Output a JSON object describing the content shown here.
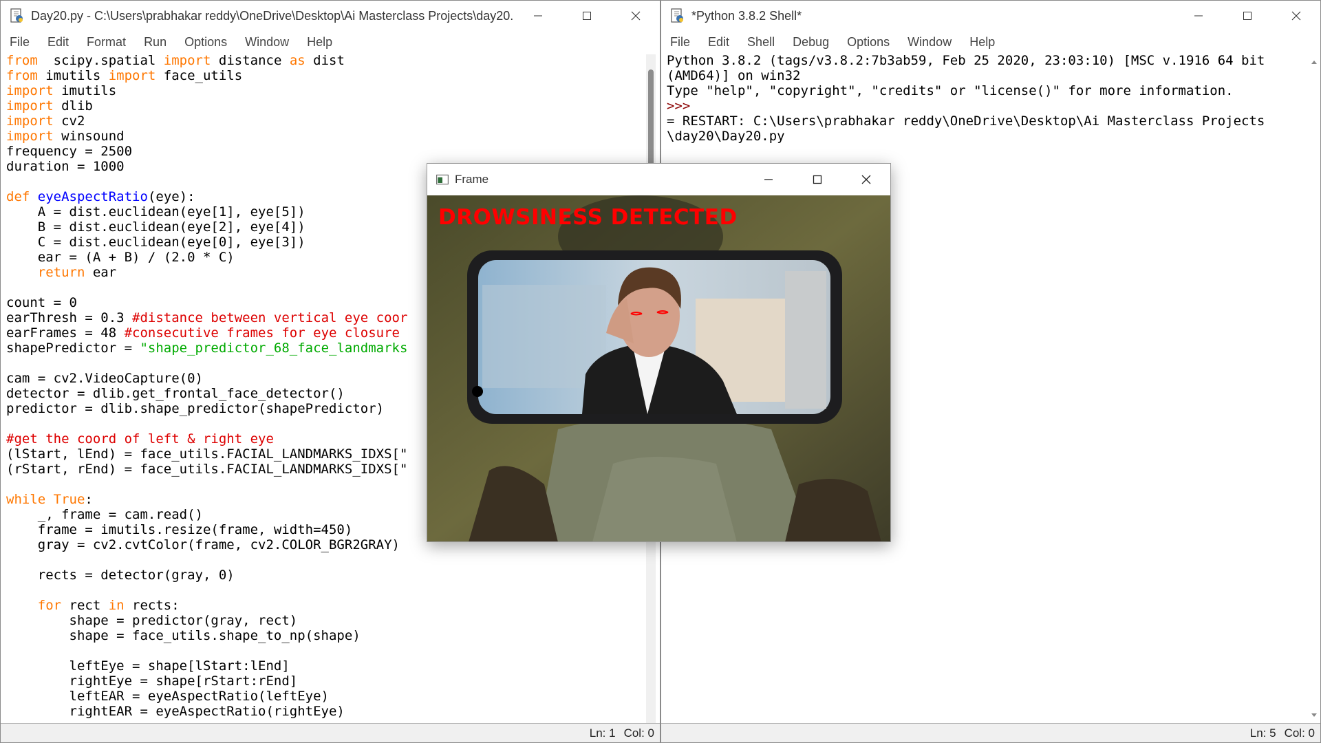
{
  "editor": {
    "title": "Day20.py - C:\\Users\\prabhakar reddy\\OneDrive\\Desktop\\Ai Masterclass Projects\\day20...",
    "menu": [
      "File",
      "Edit",
      "Format",
      "Run",
      "Options",
      "Window",
      "Help"
    ],
    "status": {
      "line": "Ln: 1",
      "col": "Col: 0"
    },
    "code_lines": [
      [
        [
          "kw",
          "from"
        ],
        [
          "",
          "  scipy.spatial "
        ],
        [
          "kw",
          "import"
        ],
        [
          "",
          " distance "
        ],
        [
          "kw",
          "as"
        ],
        [
          "",
          " dist"
        ]
      ],
      [
        [
          "kw",
          "from"
        ],
        [
          "",
          " imutils "
        ],
        [
          "kw",
          "import"
        ],
        [
          "",
          " face_utils"
        ]
      ],
      [
        [
          "kw",
          "import"
        ],
        [
          "",
          " imutils"
        ]
      ],
      [
        [
          "kw",
          "import"
        ],
        [
          "",
          " dlib"
        ]
      ],
      [
        [
          "kw",
          "import"
        ],
        [
          "",
          " cv2"
        ]
      ],
      [
        [
          "kw",
          "import"
        ],
        [
          "",
          " winsound"
        ]
      ],
      [
        [
          "",
          "frequency = 2500"
        ]
      ],
      [
        [
          "",
          "duration = 1000"
        ]
      ],
      [
        [
          "",
          ""
        ]
      ],
      [
        [
          "kw",
          "def"
        ],
        [
          "",
          " "
        ],
        [
          "fn",
          "eyeAspectRatio"
        ],
        [
          "",
          "(eye):"
        ]
      ],
      [
        [
          "",
          "    A = dist.euclidean(eye[1], eye[5])"
        ]
      ],
      [
        [
          "",
          "    B = dist.euclidean(eye[2], eye[4])"
        ]
      ],
      [
        [
          "",
          "    C = dist.euclidean(eye[0], eye[3])"
        ]
      ],
      [
        [
          "",
          "    ear = (A + B) / (2.0 * C)"
        ]
      ],
      [
        [
          "kw",
          "    return"
        ],
        [
          "",
          " ear"
        ]
      ],
      [
        [
          "",
          ""
        ]
      ],
      [
        [
          "",
          "count = 0"
        ]
      ],
      [
        [
          "",
          "earThresh = 0.3 "
        ],
        [
          "cm",
          "#distance between vertical eye coor"
        ]
      ],
      [
        [
          "",
          "earFrames = 48 "
        ],
        [
          "cm",
          "#consecutive frames for eye closure"
        ]
      ],
      [
        [
          "",
          "shapePredictor = "
        ],
        [
          "st",
          "\"shape_predictor_68_face_landmarks"
        ]
      ],
      [
        [
          "",
          ""
        ]
      ],
      [
        [
          "",
          "cam = cv2.VideoCapture(0)"
        ]
      ],
      [
        [
          "",
          "detector = dlib.get_frontal_face_detector()"
        ]
      ],
      [
        [
          "",
          "predictor = dlib.shape_predictor(shapePredictor)"
        ]
      ],
      [
        [
          "",
          ""
        ]
      ],
      [
        [
          "cm",
          "#get the coord of left & right eye"
        ]
      ],
      [
        [
          "",
          "(lStart, lEnd) = face_utils.FACIAL_LANDMARKS_IDXS[\""
        ]
      ],
      [
        [
          "",
          "(rStart, rEnd) = face_utils.FACIAL_LANDMARKS_IDXS[\""
        ]
      ],
      [
        [
          "",
          ""
        ]
      ],
      [
        [
          "kw",
          "while"
        ],
        [
          "",
          " "
        ],
        [
          "kw",
          "True"
        ],
        [
          "",
          ":"
        ]
      ],
      [
        [
          "",
          "    _, frame = cam.read()"
        ]
      ],
      [
        [
          "",
          "    frame = imutils.resize(frame, width=450)"
        ]
      ],
      [
        [
          "",
          "    gray = cv2.cvtColor(frame, cv2.COLOR_BGR2GRAY)"
        ]
      ],
      [
        [
          "",
          ""
        ]
      ],
      [
        [
          "",
          "    rects = detector(gray, 0)"
        ]
      ],
      [
        [
          "",
          ""
        ]
      ],
      [
        [
          "kw",
          "    for"
        ],
        [
          "",
          " rect "
        ],
        [
          "kw",
          "in"
        ],
        [
          "",
          " rects:"
        ]
      ],
      [
        [
          "",
          "        shape = predictor(gray, rect)"
        ]
      ],
      [
        [
          "",
          "        shape = face_utils.shape_to_np(shape)"
        ]
      ],
      [
        [
          "",
          ""
        ]
      ],
      [
        [
          "",
          "        leftEye = shape[lStart:lEnd]"
        ]
      ],
      [
        [
          "",
          "        rightEye = shape[rStart:rEnd]"
        ]
      ],
      [
        [
          "",
          "        leftEAR = eyeAspectRatio(leftEye)"
        ]
      ],
      [
        [
          "",
          "        rightEAR = eyeAspectRatio(rightEye)"
        ]
      ]
    ]
  },
  "shell": {
    "title": "*Python 3.8.2 Shell*",
    "menu": [
      "File",
      "Edit",
      "Shell",
      "Debug",
      "Options",
      "Window",
      "Help"
    ],
    "status": {
      "line": "Ln: 5",
      "col": "Col: 0"
    },
    "output_lines": [
      [
        [
          "",
          "Python 3.8.2 (tags/v3.8.2:7b3ab59, Feb 25 2020, 23:03:10) [MSC v.1916 64 bit"
        ]
      ],
      [
        [
          "",
          "(AMD64)] on win32"
        ]
      ],
      [
        [
          "",
          "Type \"help\", \"copyright\", \"credits\" or \"license()\" for more information."
        ]
      ],
      [
        [
          "pr",
          ">>> "
        ]
      ],
      [
        [
          "",
          "= RESTART: C:\\Users\\prabhakar reddy\\OneDrive\\Desktop\\Ai Masterclass Projects"
        ]
      ],
      [
        [
          "",
          "\\day20\\Day20.py"
        ]
      ]
    ]
  },
  "frame": {
    "title": "Frame",
    "alert_text": "DROWSINESS DETECTED",
    "alert_color": "#ff0000"
  },
  "colors": {
    "keyword": "#ff7700",
    "function": "#0000ff",
    "comment": "#dd0000",
    "string": "#00aa00"
  }
}
